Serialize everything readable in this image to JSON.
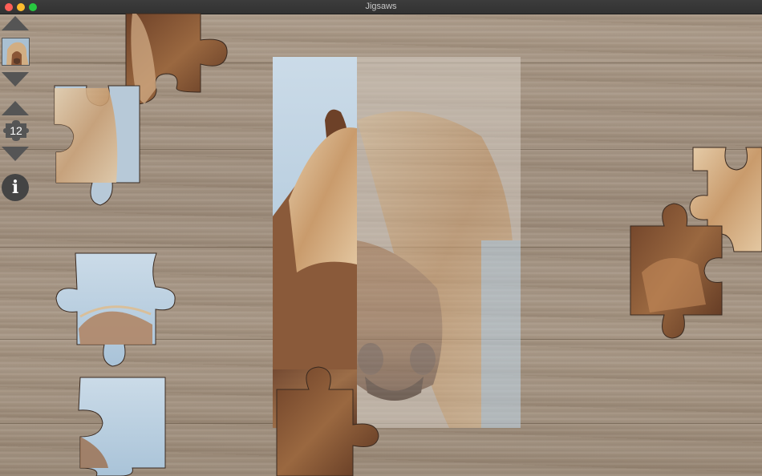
{
  "window": {
    "title": "Jigsaws"
  },
  "toolbar": {
    "pieces_count": "12",
    "buttons": {
      "thumb_prev": "up-arrow-icon",
      "thumb_next": "down-arrow-icon",
      "count_up": "up-arrow-icon",
      "count_down": "down-arrow-icon",
      "info": "info-icon"
    },
    "info_label": "i"
  },
  "colors": {
    "table_wood": "#a39282",
    "titlebar": "#363636",
    "toolbar_icons": "#555555",
    "sky": "#b9cfe0",
    "mane": "#d8b890",
    "horse_body": "#7a4f32"
  }
}
